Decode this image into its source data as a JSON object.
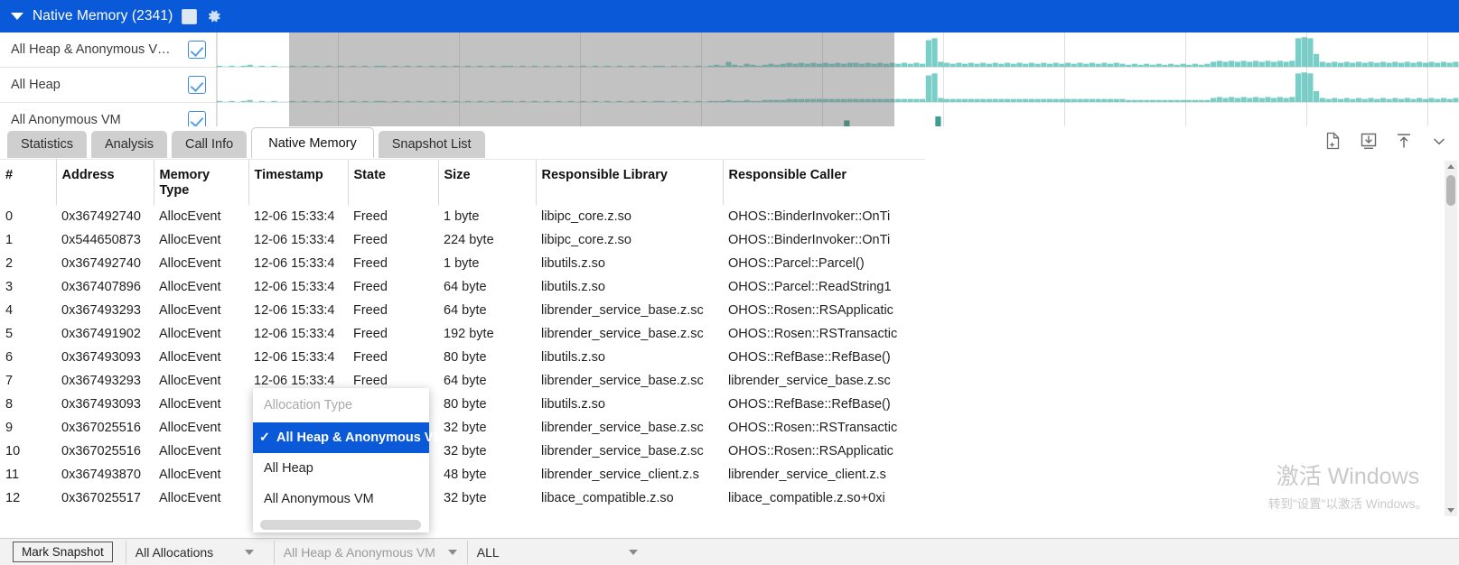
{
  "titlebar": {
    "expand_icon": "triangle-down-icon",
    "title": "Native Memory (2341)",
    "checkbox_icon": "checkbox-unchecked-icon",
    "settings_icon": "gear-icon"
  },
  "chart": {
    "legend_rows": [
      {
        "label": "All Heap & Anonymous V…",
        "checked": true
      },
      {
        "label": "All Heap",
        "checked": true
      },
      {
        "label": "All Anonymous VM",
        "checked": true
      }
    ],
    "series_color": "#79cfc8",
    "selection_overlay_color": "#6e6e6e"
  },
  "chart_data": {
    "type": "area",
    "title": "Native Memory (2341)",
    "xlabel": "",
    "ylabel": "",
    "grid": true,
    "legend_position": "left",
    "series": [
      {
        "name": "All Heap & Anonymous VM",
        "color": "#79cfc8",
        "values": [
          2,
          1,
          2,
          1,
          2,
          3,
          1,
          2,
          1,
          2,
          1,
          1,
          2,
          1,
          2,
          1,
          2,
          1,
          2,
          1,
          2,
          1,
          2,
          1,
          2,
          1,
          2,
          2,
          1,
          2,
          1,
          2,
          1,
          2,
          1,
          2,
          1,
          2,
          1,
          2,
          1,
          2,
          1,
          2,
          1,
          2,
          1,
          2,
          2,
          1,
          2,
          1,
          2,
          1,
          2,
          1,
          2,
          1,
          2,
          1,
          2,
          1,
          2,
          1,
          2,
          1,
          2,
          1,
          2,
          1,
          2,
          1,
          2,
          2,
          1,
          2,
          1,
          2,
          1,
          2,
          1,
          2,
          3,
          2,
          6,
          3,
          2,
          4,
          3,
          2,
          3,
          4,
          3,
          4,
          5,
          4,
          5,
          4,
          5,
          4,
          5,
          4,
          5,
          4,
          5,
          5,
          4,
          5,
          4,
          5,
          4,
          5,
          4,
          5,
          4,
          5,
          4,
          28,
          30,
          6,
          5,
          4,
          5,
          4,
          5,
          4,
          5,
          4,
          5,
          4,
          5,
          4,
          5,
          4,
          5,
          4,
          5,
          4,
          5,
          4,
          5,
          4,
          5,
          4,
          5,
          4,
          5,
          4,
          5,
          4,
          3,
          4,
          3,
          4,
          3,
          4,
          3,
          4,
          3,
          4,
          3,
          4,
          3,
          4,
          6,
          7,
          6,
          7,
          6,
          7,
          6,
          7,
          6,
          7,
          6,
          7,
          6,
          7,
          30,
          31,
          30,
          14,
          6,
          5,
          6,
          5,
          6,
          5,
          6,
          5,
          6,
          5,
          6,
          5,
          6,
          5,
          6,
          5,
          6,
          5,
          6,
          5,
          6,
          5,
          6
        ]
      },
      {
        "name": "All Heap",
        "color": "#79cfc8",
        "values": [
          2,
          1,
          2,
          1,
          2,
          3,
          1,
          2,
          1,
          2,
          1,
          1,
          2,
          1,
          2,
          1,
          2,
          1,
          2,
          1,
          2,
          1,
          2,
          1,
          2,
          1,
          2,
          2,
          1,
          2,
          1,
          2,
          1,
          2,
          1,
          2,
          1,
          2,
          1,
          2,
          1,
          2,
          1,
          2,
          1,
          2,
          1,
          2,
          2,
          1,
          2,
          1,
          2,
          1,
          2,
          1,
          2,
          1,
          2,
          1,
          2,
          1,
          2,
          1,
          2,
          1,
          2,
          1,
          2,
          1,
          2,
          1,
          2,
          2,
          1,
          2,
          1,
          2,
          1,
          2,
          1,
          2,
          2,
          2,
          3,
          2,
          2,
          3,
          2,
          2,
          3,
          3,
          3,
          3,
          4,
          4,
          4,
          4,
          4,
          4,
          4,
          4,
          4,
          4,
          4,
          4,
          4,
          4,
          4,
          4,
          4,
          4,
          4,
          4,
          4,
          4,
          4,
          28,
          30,
          5,
          4,
          4,
          4,
          4,
          4,
          4,
          4,
          4,
          4,
          4,
          4,
          4,
          4,
          4,
          4,
          4,
          4,
          4,
          4,
          4,
          4,
          4,
          4,
          4,
          4,
          4,
          4,
          4,
          4,
          4,
          3,
          3,
          3,
          3,
          3,
          3,
          3,
          3,
          3,
          3,
          3,
          3,
          3,
          3,
          5,
          6,
          5,
          6,
          5,
          6,
          5,
          6,
          5,
          6,
          5,
          6,
          5,
          6,
          30,
          31,
          30,
          12,
          5,
          4,
          5,
          4,
          5,
          4,
          5,
          4,
          5,
          4,
          5,
          4,
          5,
          4,
          5,
          4,
          5,
          4,
          5,
          4,
          5,
          4,
          5
        ]
      },
      {
        "name": "All Anonymous VM",
        "color": "#3f9c95",
        "values": [
          0,
          0,
          0,
          0,
          0,
          0,
          0,
          0,
          0,
          0,
          0,
          0,
          0,
          0,
          0,
          0,
          0,
          0,
          0,
          0,
          0,
          0,
          0,
          0,
          0,
          0,
          0,
          0,
          0,
          0,
          0,
          0,
          0,
          0,
          0,
          0,
          0,
          0,
          0,
          0,
          0,
          0,
          0,
          0,
          0,
          0,
          0,
          0,
          0,
          0,
          0,
          0,
          0,
          0,
          0,
          0,
          0,
          0,
          0,
          0,
          0,
          0,
          0,
          0,
          0,
          0,
          0,
          0,
          0,
          0,
          0,
          0,
          0,
          0,
          0,
          0,
          0,
          0,
          0,
          0,
          0,
          0,
          0,
          0,
          0,
          0,
          0,
          0,
          0,
          0,
          0,
          0,
          0,
          0,
          0,
          0,
          0,
          0,
          0,
          0,
          0,
          0,
          0,
          18,
          0,
          0,
          0,
          0,
          0,
          0,
          0,
          0,
          0,
          0,
          0,
          0,
          0,
          0,
          22,
          0,
          0,
          0,
          0,
          0,
          0,
          0,
          0,
          0,
          0,
          0,
          0,
          0,
          0,
          0,
          0,
          0,
          0,
          0,
          0,
          0,
          0,
          0,
          0,
          0,
          0,
          0,
          0,
          0,
          0,
          0,
          0,
          0,
          0,
          0,
          0,
          0,
          0,
          0,
          0,
          0,
          0,
          0,
          0,
          0,
          0,
          0,
          0,
          0,
          0,
          0,
          0,
          0,
          0,
          0,
          0,
          0,
          0,
          0,
          0,
          0,
          0,
          0,
          0,
          0,
          0,
          0,
          0,
          0,
          0,
          0,
          0,
          0,
          0,
          0,
          0,
          0,
          0,
          0,
          0,
          0,
          0,
          0,
          0,
          0
        ]
      }
    ],
    "selection": {
      "start_fraction": 0.058,
      "end_fraction": 0.545
    }
  },
  "tabs": [
    {
      "label": "Statistics",
      "active": false
    },
    {
      "label": "Analysis",
      "active": false
    },
    {
      "label": "Call Info",
      "active": false
    },
    {
      "label": "Native Memory",
      "active": true
    },
    {
      "label": "Snapshot List",
      "active": false
    }
  ],
  "toolbar_icons": [
    {
      "name": "file-add-icon"
    },
    {
      "name": "import-download-icon"
    },
    {
      "name": "export-upload-icon"
    },
    {
      "name": "chevron-down-icon"
    }
  ],
  "table": {
    "columns": [
      "#",
      "Address",
      "Memory\nType",
      "Timestamp",
      "State",
      "Size",
      "Responsible Library",
      "Responsible Caller"
    ],
    "columns_display": {
      "idx": "#",
      "address": "Address",
      "memory_type_l1": "Memory",
      "memory_type_l2": "Type",
      "timestamp": "Timestamp",
      "state": "State",
      "size": "Size",
      "library": "Responsible Library",
      "caller": "Responsible Caller"
    },
    "rows": [
      {
        "idx": "0",
        "address": "0x367492740",
        "memory_type": "AllocEvent",
        "timestamp": "12-06 15:33:4",
        "state": "Freed",
        "size": "1 byte",
        "library": "libipc_core.z.so",
        "caller": "OHOS::BinderInvoker::OnTi"
      },
      {
        "idx": "1",
        "address": "0x544650873",
        "memory_type": "AllocEvent",
        "timestamp": "12-06 15:33:4",
        "state": "Freed",
        "size": "224 byte",
        "library": "libipc_core.z.so",
        "caller": "OHOS::BinderInvoker::OnTi"
      },
      {
        "idx": "2",
        "address": "0x367492740",
        "memory_type": "AllocEvent",
        "timestamp": "12-06 15:33:4",
        "state": "Freed",
        "size": "1 byte",
        "library": "libutils.z.so",
        "caller": "OHOS::Parcel::Parcel()"
      },
      {
        "idx": "3",
        "address": "0x367407896",
        "memory_type": "AllocEvent",
        "timestamp": "12-06 15:33:4",
        "state": "Freed",
        "size": "64 byte",
        "library": "libutils.z.so",
        "caller": "OHOS::Parcel::ReadString1"
      },
      {
        "idx": "4",
        "address": "0x367493293",
        "memory_type": "AllocEvent",
        "timestamp": "12-06 15:33:4",
        "state": "Freed",
        "size": "64 byte",
        "library": "librender_service_base.z.sc",
        "caller": "OHOS::Rosen::RSApplicatic"
      },
      {
        "idx": "5",
        "address": "0x367491902",
        "memory_type": "AllocEvent",
        "timestamp": "12-06 15:33:4",
        "state": "Freed",
        "size": "192 byte",
        "library": "librender_service_base.z.sc",
        "caller": "OHOS::Rosen::RSTransactic"
      },
      {
        "idx": "6",
        "address": "0x367493093",
        "memory_type": "AllocEvent",
        "timestamp": "12-06 15:33:4",
        "state": "Freed",
        "size": "80 byte",
        "library": "libutils.z.so",
        "caller": "OHOS::RefBase::RefBase()"
      },
      {
        "idx": "7",
        "address": "0x367493293",
        "memory_type": "AllocEvent",
        "timestamp": "12-06 15:33:4",
        "state": "Freed",
        "size": "64 byte",
        "library": "librender_service_base.z.sc",
        "caller": "librender_service_base.z.sc"
      },
      {
        "idx": "8",
        "address": "0x367493093",
        "memory_type": "AllocEvent",
        "timestamp": "",
        "state": "",
        "size": "80 byte",
        "library": "libutils.z.so",
        "caller": "OHOS::RefBase::RefBase()"
      },
      {
        "idx": "9",
        "address": "0x367025516",
        "memory_type": "AllocEvent",
        "timestamp": "",
        "state": "",
        "size": "32 byte",
        "library": "librender_service_base.z.sc",
        "caller": "OHOS::Rosen::RSTransactic"
      },
      {
        "idx": "10",
        "address": "0x367025516",
        "memory_type": "AllocEvent",
        "timestamp": "",
        "state": "",
        "size": "32 byte",
        "library": "librender_service_base.z.sc",
        "caller": "OHOS::Rosen::RSApplicatic"
      },
      {
        "idx": "11",
        "address": "0x367493870",
        "memory_type": "AllocEvent",
        "timestamp": "",
        "state": "",
        "size": "48 byte",
        "library": "librender_service_client.z.s",
        "caller": "librender_service_client.z.s"
      },
      {
        "idx": "12",
        "address": "0x367025517",
        "memory_type": "AllocEvent",
        "timestamp": "",
        "state": "",
        "size": "32 byte",
        "library": "libace_compatible.z.so",
        "caller": "libace_compatible.z.so+0xi"
      }
    ]
  },
  "dropdown": {
    "placeholder": "Allocation Type",
    "check_icon": "check-icon",
    "items": [
      {
        "label": "All Heap & Anonymous VM",
        "selected": true
      },
      {
        "label": "All Heap",
        "selected": false
      },
      {
        "label": "All Anonymous VM",
        "selected": false
      }
    ]
  },
  "bottombar": {
    "mark_snapshot": "Mark Snapshot",
    "allocations_select": "All Allocations",
    "heap_select": "All Heap & Anonymous VM",
    "all_select": "ALL",
    "chevron_icon": "chevron-down-icon"
  },
  "watermark": {
    "line1": "激活 Windows",
    "line2": "转到\"设置\"以激活 Windows。"
  }
}
